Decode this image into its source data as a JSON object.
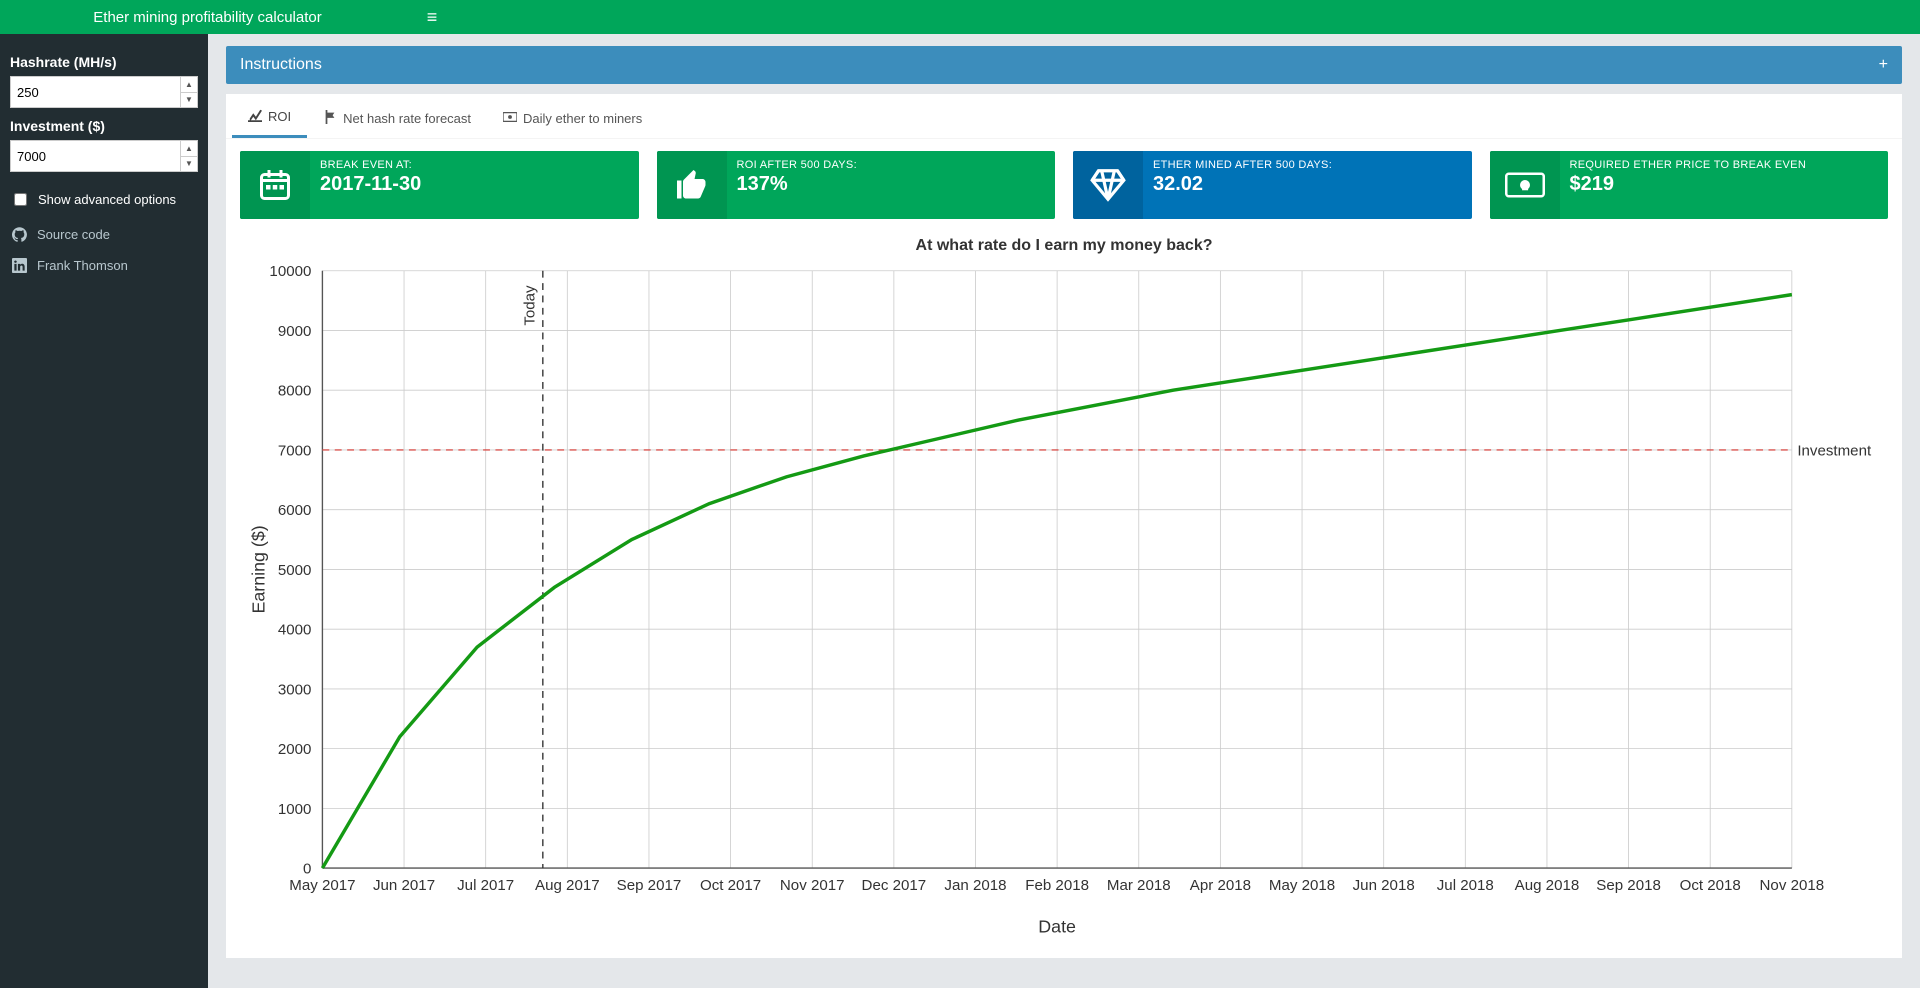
{
  "header": {
    "title": "Ether mining profitability calculator",
    "toggle_icon": "≡"
  },
  "sidebar": {
    "hashrate_label": "Hashrate (MH/s)",
    "hashrate_value": "250",
    "investment_label": "Investment ($)",
    "investment_value": "7000",
    "advanced_label": "Show advanced options",
    "nav": [
      {
        "icon": "github",
        "label": "Source code"
      },
      {
        "icon": "linkedin",
        "label": "Frank Thomson"
      }
    ]
  },
  "instructions": {
    "title": "Instructions",
    "plus": "+"
  },
  "tabs": [
    {
      "icon": "chart-line",
      "label": "ROI",
      "active": true
    },
    {
      "icon": "flag",
      "label": "Net hash rate forecast",
      "active": false
    },
    {
      "icon": "money",
      "label": "Daily ether to miners",
      "active": false
    }
  ],
  "kpis": [
    {
      "style": "green",
      "icon": "calendar",
      "label": "BREAK EVEN AT:",
      "value": "2017-11-30"
    },
    {
      "style": "green",
      "icon": "thumbs-up",
      "label": "ROI AFTER 500 DAYS:",
      "value": "137%"
    },
    {
      "style": "blue",
      "icon": "diamond",
      "label": "ETHER MINED AFTER 500 DAYS:",
      "value": "32.02"
    },
    {
      "style": "green",
      "icon": "cash",
      "label": "REQUIRED ETHER PRICE TO BREAK EVEN",
      "value": "$219"
    }
  ],
  "chart_data": {
    "type": "line",
    "title": "At what rate do I earn my money back?",
    "xlabel": "Date",
    "ylabel": "Earning ($)",
    "ylim": [
      0,
      10000
    ],
    "yticks": [
      0,
      1000,
      2000,
      3000,
      4000,
      5000,
      6000,
      7000,
      8000,
      9000,
      10000
    ],
    "x_categories": [
      "May 2017",
      "Jun 2017",
      "Jul 2017",
      "Aug 2017",
      "Sep 2017",
      "Oct 2017",
      "Nov 2017",
      "Dec 2017",
      "Jan 2018",
      "Feb 2018",
      "Mar 2018",
      "Apr 2018",
      "May 2018",
      "Jun 2018",
      "Jul 2018",
      "Aug 2018",
      "Sep 2018",
      "Oct 2018",
      "Nov 2018"
    ],
    "today_index": 2.7,
    "today_label": "Today",
    "investment_line": 7000,
    "investment_label": "Investment",
    "series": [
      {
        "name": "earnings",
        "values": [
          0,
          2200,
          3700,
          4700,
          5500,
          6100,
          6550,
          6900,
          7200,
          7500,
          7750,
          8000,
          8200,
          8400,
          8600,
          8800,
          9000,
          9200,
          9400,
          9600
        ]
      }
    ]
  }
}
